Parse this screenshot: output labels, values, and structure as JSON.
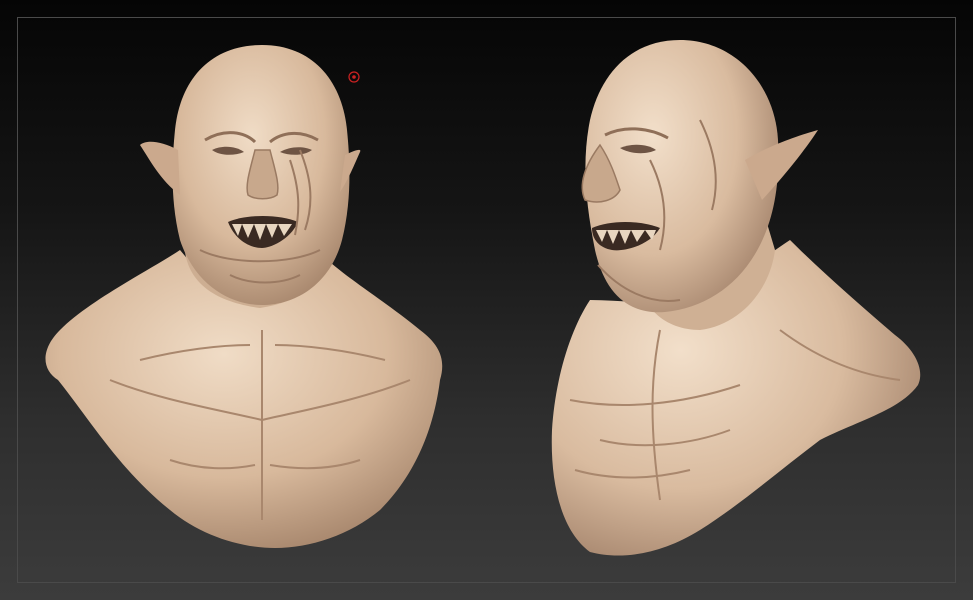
{
  "canvas": {
    "background_top": "#050505",
    "background_bottom": "#3c3c3c",
    "frame_color": "#4a4a4a"
  },
  "model": {
    "material_color": "#d8b99c",
    "shadow_color": "#9c7b62",
    "highlight_color": "#f0dcc6",
    "views": [
      "front-view",
      "three-quarter-view"
    ]
  },
  "cursor": {
    "icon": "brush-cursor-icon",
    "color": "#cc2222"
  }
}
